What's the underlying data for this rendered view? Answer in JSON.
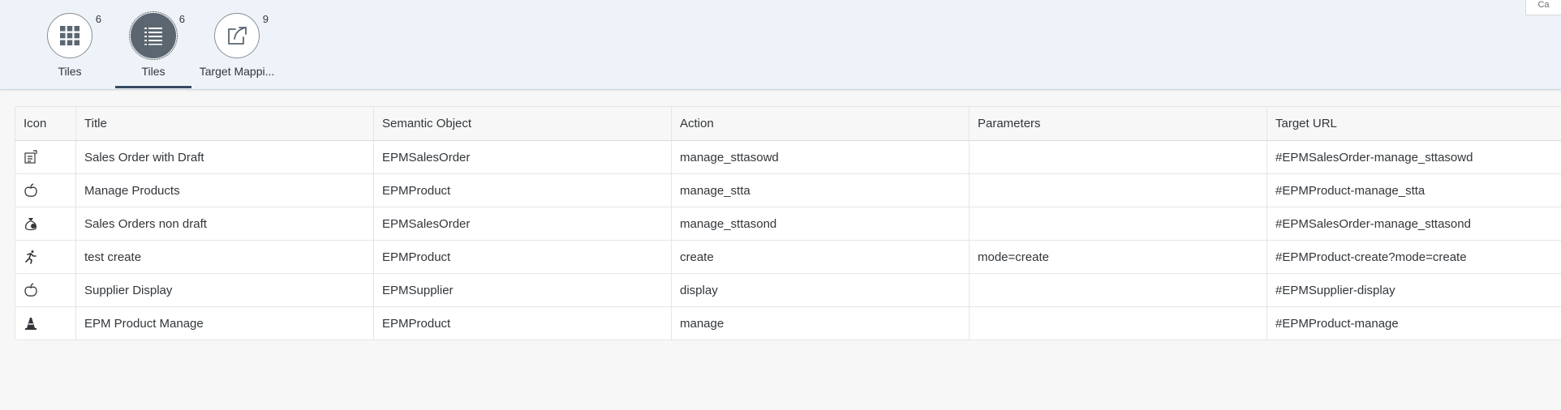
{
  "corner": {
    "label": "Ca"
  },
  "tabs": [
    {
      "label": "Tiles",
      "count": "6",
      "icon": "grid-icon",
      "selected": false
    },
    {
      "label": "Tiles",
      "count": "6",
      "icon": "list-icon",
      "selected": true
    },
    {
      "label": "Target Mappi...",
      "count": "9",
      "icon": "share-icon",
      "selected": false
    }
  ],
  "table": {
    "headers": [
      "Icon",
      "Title",
      "Semantic Object",
      "Action",
      "Parameters",
      "Target URL"
    ],
    "rows": [
      {
        "icon": "sales-order-icon",
        "title": "Sales Order with Draft",
        "semantic_object": "EPMSalesOrder",
        "action": "manage_sttasowd",
        "parameters": "",
        "target_url": "#EPMSalesOrder-manage_sttasowd"
      },
      {
        "icon": "apple-icon",
        "title": "Manage Products",
        "semantic_object": "EPMProduct",
        "action": "manage_stta",
        "parameters": "",
        "target_url": "#EPMProduct-manage_stta"
      },
      {
        "icon": "money-bag-icon",
        "title": "Sales Orders non draft",
        "semantic_object": "EPMSalesOrder",
        "action": "manage_sttasond",
        "parameters": "",
        "target_url": "#EPMSalesOrder-manage_sttasond"
      },
      {
        "icon": "running-person-icon",
        "title": "test create",
        "semantic_object": "EPMProduct",
        "action": "create",
        "parameters": "mode=create",
        "target_url": "#EPMProduct-create?mode=create"
      },
      {
        "icon": "apple-icon",
        "title": "Supplier Display",
        "semantic_object": "EPMSupplier",
        "action": "display",
        "parameters": "",
        "target_url": "#EPMSupplier-display"
      },
      {
        "icon": "traffic-cone-icon",
        "title": "EPM Product Manage",
        "semantic_object": "EPMProduct",
        "action": "manage",
        "parameters": "",
        "target_url": "#EPMProduct-manage"
      }
    ]
  }
}
